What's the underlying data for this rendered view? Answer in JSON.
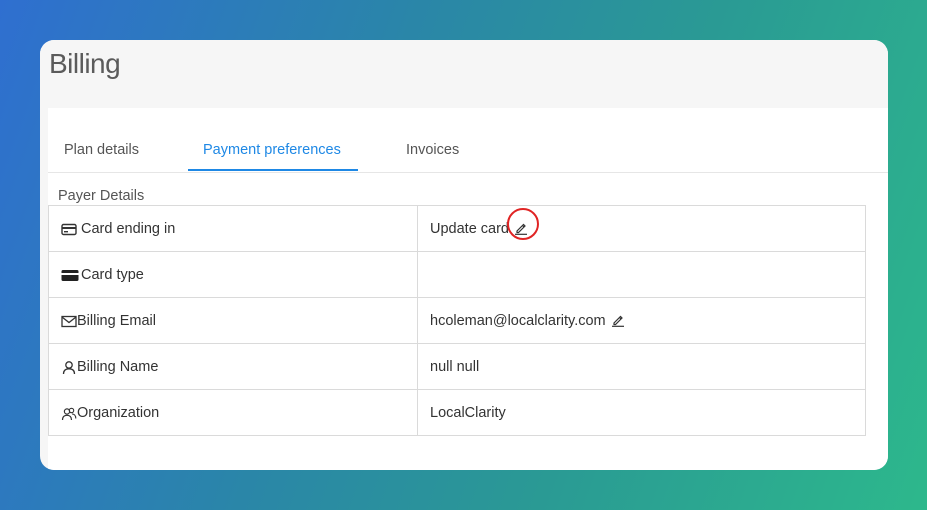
{
  "page": {
    "title": "Billing"
  },
  "tabs": [
    {
      "label": "Plan details",
      "active": false
    },
    {
      "label": "Payment preferences",
      "active": true
    },
    {
      "label": "Invoices",
      "active": false
    }
  ],
  "payer_details": {
    "section_label": "Payer Details",
    "rows": [
      {
        "label": "Card ending in",
        "icon": "credit-card-outline-icon",
        "value": "Update card",
        "editable": true
      },
      {
        "label": "Card type",
        "icon": "credit-card-icon",
        "value": "",
        "editable": false
      },
      {
        "label": "Billing Email",
        "icon": "envelope-icon",
        "value": "hcoleman@localclarity.com",
        "editable": true
      },
      {
        "label": "Billing Name",
        "icon": "user-icon",
        "value": "null null",
        "editable": false
      },
      {
        "label": "Organization",
        "icon": "users-icon",
        "value": "LocalClarity",
        "editable": false
      }
    ]
  },
  "colors": {
    "accent": "#1e88e5",
    "highlight": "#e02424"
  }
}
